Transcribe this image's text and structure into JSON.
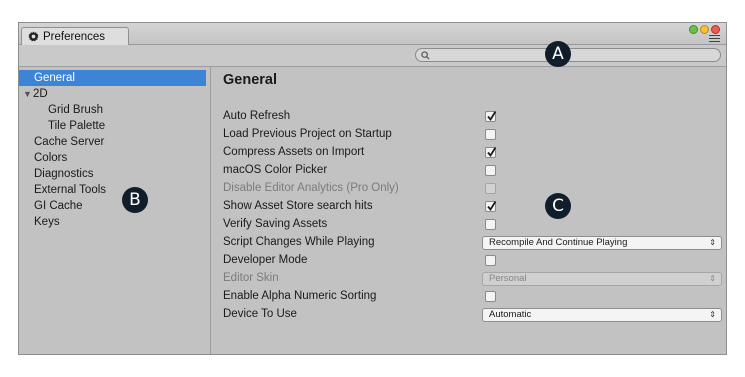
{
  "window": {
    "tab_label": "Preferences",
    "search": {
      "placeholder": "",
      "value": ""
    }
  },
  "callouts": {
    "a": "A",
    "b": "B",
    "c": "C"
  },
  "sidebar": {
    "items": [
      {
        "label": "General",
        "selected": true
      },
      {
        "label": "2D",
        "expanded": true
      },
      {
        "label": "Grid Brush",
        "child": true
      },
      {
        "label": "Tile Palette",
        "child": true
      },
      {
        "label": "Cache Server"
      },
      {
        "label": "Colors"
      },
      {
        "label": "Diagnostics"
      },
      {
        "label": "External Tools"
      },
      {
        "label": "GI Cache"
      },
      {
        "label": "Keys"
      }
    ]
  },
  "content": {
    "title": "General",
    "rows": [
      {
        "label": "Auto Refresh",
        "type": "checkbox",
        "checked": true
      },
      {
        "label": "Load Previous Project on Startup",
        "type": "checkbox",
        "checked": false
      },
      {
        "label": "Compress Assets on Import",
        "type": "checkbox",
        "checked": true
      },
      {
        "label": "macOS Color Picker",
        "type": "checkbox",
        "checked": false
      },
      {
        "label": "Disable Editor Analytics (Pro Only)",
        "type": "checkbox",
        "checked": false,
        "disabled": true
      },
      {
        "label": "Show Asset Store search hits",
        "type": "checkbox",
        "checked": true
      },
      {
        "label": "Verify Saving Assets",
        "type": "checkbox",
        "checked": false
      },
      {
        "label": "Script Changes While Playing",
        "type": "select",
        "value": "Recompile And Continue Playing"
      },
      {
        "label": "Developer Mode",
        "type": "checkbox",
        "checked": false
      },
      {
        "label": "Editor Skin",
        "type": "select",
        "value": "Personal",
        "disabled": true
      },
      {
        "label": "Enable Alpha Numeric Sorting",
        "type": "checkbox",
        "checked": false
      },
      {
        "label": "Device To Use",
        "type": "select",
        "value": "Automatic"
      }
    ]
  },
  "colors": {
    "selection": "#3d84d6",
    "callout": "#121d2c",
    "panel": "#c2c2c2"
  }
}
